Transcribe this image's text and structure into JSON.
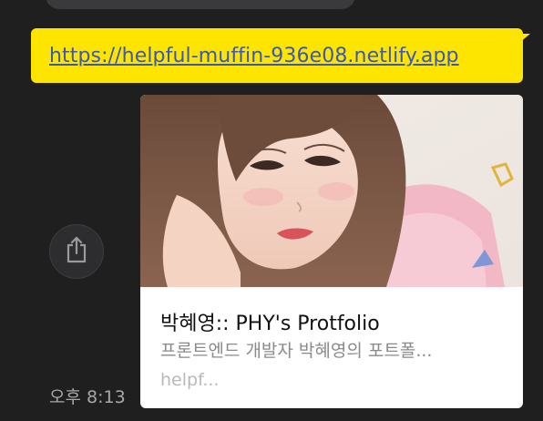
{
  "message": {
    "link_url": "https://helpful-muffin-936e08.netlify.app",
    "time": "오후 8:13"
  },
  "preview_card": {
    "title": "박혜영:: PHY's Protfolio",
    "description": "프론트엔드 개발자 박혜영의 포트폴...",
    "domain": "helpf..."
  },
  "icons": {
    "share": "share-icon"
  },
  "colors": {
    "chat_background": "#1f1f1f",
    "my_bubble": "#fee500",
    "link_text": "#3a58b8",
    "card_background": "#ffffff"
  }
}
